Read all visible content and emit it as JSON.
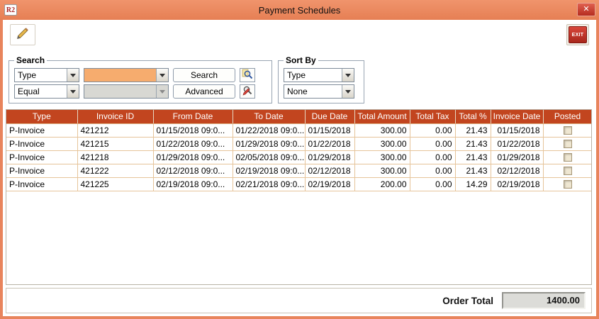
{
  "window": {
    "title": "Payment Schedules",
    "logo": "R2",
    "close_glyph": "✕"
  },
  "toolbar": {
    "exit_label": "EXIT"
  },
  "search": {
    "legend": "Search",
    "field": "Type",
    "operator": "Equal",
    "value": "",
    "search_button": "Search",
    "advanced_button": "Advanced"
  },
  "sort_by": {
    "legend": "Sort By",
    "primary": "Type",
    "secondary": "None"
  },
  "table": {
    "columns": [
      "Type",
      "Invoice ID",
      "From Date",
      "To Date",
      "Due Date",
      "Total Amount",
      "Total Tax",
      "Total %",
      "Invoice Date",
      "Posted"
    ],
    "rows": [
      {
        "type": "P-Invoice",
        "invoice_id": "421212",
        "from_date": "01/15/2018 09:0...",
        "to_date": "01/22/2018 09:0...",
        "due_date": "01/15/2018",
        "total_amount": "300.00",
        "total_tax": "0.00",
        "total_pct": "21.43",
        "invoice_date": "01/15/2018",
        "posted": false
      },
      {
        "type": "P-Invoice",
        "invoice_id": "421215",
        "from_date": "01/22/2018 09:0...",
        "to_date": "01/29/2018 09:0...",
        "due_date": "01/22/2018",
        "total_amount": "300.00",
        "total_tax": "0.00",
        "total_pct": "21.43",
        "invoice_date": "01/22/2018",
        "posted": false
      },
      {
        "type": "P-Invoice",
        "invoice_id": "421218",
        "from_date": "01/29/2018 09:0...",
        "to_date": "02/05/2018 09:0...",
        "due_date": "01/29/2018",
        "total_amount": "300.00",
        "total_tax": "0.00",
        "total_pct": "21.43",
        "invoice_date": "01/29/2018",
        "posted": false
      },
      {
        "type": "P-Invoice",
        "invoice_id": "421222",
        "from_date": "02/12/2018 09:0...",
        "to_date": "02/19/2018 09:0...",
        "due_date": "02/12/2018",
        "total_amount": "300.00",
        "total_tax": "0.00",
        "total_pct": "21.43",
        "invoice_date": "02/12/2018",
        "posted": false
      },
      {
        "type": "P-Invoice",
        "invoice_id": "421225",
        "from_date": "02/19/2018 09:0...",
        "to_date": "02/21/2018 09:0...",
        "due_date": "02/19/2018",
        "total_amount": "200.00",
        "total_tax": "0.00",
        "total_pct": "14.29",
        "invoice_date": "02/19/2018",
        "posted": false
      }
    ]
  },
  "footer": {
    "order_total_label": "Order Total",
    "order_total_value": "1400.00"
  },
  "colors": {
    "titlebar": "#E8845C",
    "table_header": "#C2451F",
    "highlight": "#F6AC6E",
    "close_red": "#C5372B"
  }
}
